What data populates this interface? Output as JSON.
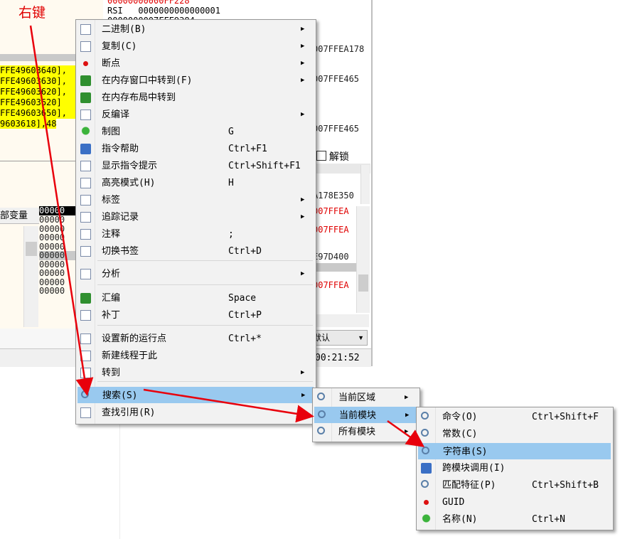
{
  "annotation": {
    "text": "右键",
    "color": "#e00000"
  },
  "registers": {
    "rows": [
      {
        "name": "RSI",
        "value": "0000000000000001"
      }
    ],
    "partial_top": "00000000000FF228",
    "partial_bottom": "0000000007FFE9384"
  },
  "asm_lines": [
    "FFE49603640],",
    "FFE49603630],",
    "FFE49603620],",
    "FFE49603620]",
    "FFE49603650],",
    "9603618],48"
  ],
  "right_values": [
    "007FFEA178",
    "007FFE465",
    "007FFE465"
  ],
  "unlock": {
    "label": "解锁"
  },
  "stack_values": [
    "A178E350",
    "007FFEA",
    "007FFEA",
    "E97D400",
    "007FFEA"
  ],
  "local_vars_label": "部变量",
  "dump_header": "00000",
  "dump_rows": [
    "00000",
    "00000",
    "00000",
    "00000",
    "00000",
    "00000",
    "00000",
    "00000",
    "00000"
  ],
  "default_select": {
    "value": "默认"
  },
  "clock": "00:21:52",
  "menu": {
    "items": [
      {
        "id": "binary",
        "label": "二进制(B)",
        "shortcut": "",
        "submenu": true
      },
      {
        "id": "copy",
        "label": "复制(C)",
        "shortcut": "",
        "submenu": true
      },
      {
        "id": "breakpoint",
        "label": "断点",
        "shortcut": "",
        "submenu": true
      },
      {
        "id": "goto-memory-window",
        "label": "在内存窗口中转到(F)",
        "shortcut": "",
        "submenu": true
      },
      {
        "id": "goto-memory-layout",
        "label": "在内存布局中转到",
        "shortcut": "",
        "submenu": false
      },
      {
        "id": "decompile",
        "label": "反编译",
        "shortcut": "",
        "submenu": true
      },
      {
        "id": "graph",
        "label": "制图",
        "shortcut": "G",
        "submenu": false
      },
      {
        "id": "instruction-help",
        "label": "指令帮助",
        "shortcut": "Ctrl+F1",
        "submenu": false
      },
      {
        "id": "show-instruction-tips",
        "label": "显示指令提示",
        "shortcut": "Ctrl+Shift+F1",
        "submenu": false
      },
      {
        "id": "highlight-mode",
        "label": "高亮模式(H)",
        "shortcut": "H",
        "submenu": false
      },
      {
        "id": "label",
        "label": "标签",
        "shortcut": "",
        "submenu": true
      },
      {
        "id": "trace-record",
        "label": "追踪记录",
        "shortcut": "",
        "submenu": true
      },
      {
        "id": "comment",
        "label": "注释",
        "shortcut": ";",
        "submenu": false
      },
      {
        "id": "toggle-bookmark",
        "label": "切换书签",
        "shortcut": "Ctrl+D",
        "submenu": false
      },
      {
        "id": "analysis",
        "label": "分析",
        "shortcut": "",
        "submenu": true
      },
      {
        "id": "assemble",
        "label": "汇编",
        "shortcut": "Space",
        "submenu": false
      },
      {
        "id": "patch",
        "label": "补丁",
        "shortcut": "Ctrl+P",
        "submenu": false
      },
      {
        "id": "set-new-origin",
        "label": "设置新的运行点",
        "shortcut": "Ctrl+*",
        "submenu": false
      },
      {
        "id": "create-thread",
        "label": "新建线程于此",
        "shortcut": "",
        "submenu": false
      },
      {
        "id": "goto",
        "label": "转到",
        "shortcut": "",
        "submenu": true
      },
      {
        "id": "search",
        "label": "搜索(S)",
        "shortcut": "",
        "submenu": true
      },
      {
        "id": "find-references",
        "label": "查找引用(R)",
        "shortcut": "",
        "submenu": true
      }
    ]
  },
  "submenu_search": {
    "items": [
      {
        "id": "current-region",
        "label": "当前区域",
        "submenu": true
      },
      {
        "id": "current-module",
        "label": "当前模块",
        "submenu": true
      },
      {
        "id": "all-modules",
        "label": "所有模块",
        "submenu": true
      }
    ]
  },
  "submenu_module": {
    "items": [
      {
        "id": "command",
        "label": "命令(O)",
        "shortcut": "Ctrl+Shift+F"
      },
      {
        "id": "constant",
        "label": "常数(C)",
        "shortcut": ""
      },
      {
        "id": "string",
        "label": "字符串(S)",
        "shortcut": ""
      },
      {
        "id": "intermodular-calls",
        "label": "跨模块调用(I)",
        "shortcut": ""
      },
      {
        "id": "pattern",
        "label": "匹配特征(P)",
        "shortcut": "Ctrl+Shift+B"
      },
      {
        "id": "guid",
        "label": "GUID",
        "shortcut": ""
      },
      {
        "id": "name",
        "label": "名称(N)",
        "shortcut": "Ctrl+N"
      }
    ]
  },
  "colors": {
    "selection": "#99c9ef",
    "arrow": "#e8000c",
    "highlight": "#ffff00"
  }
}
